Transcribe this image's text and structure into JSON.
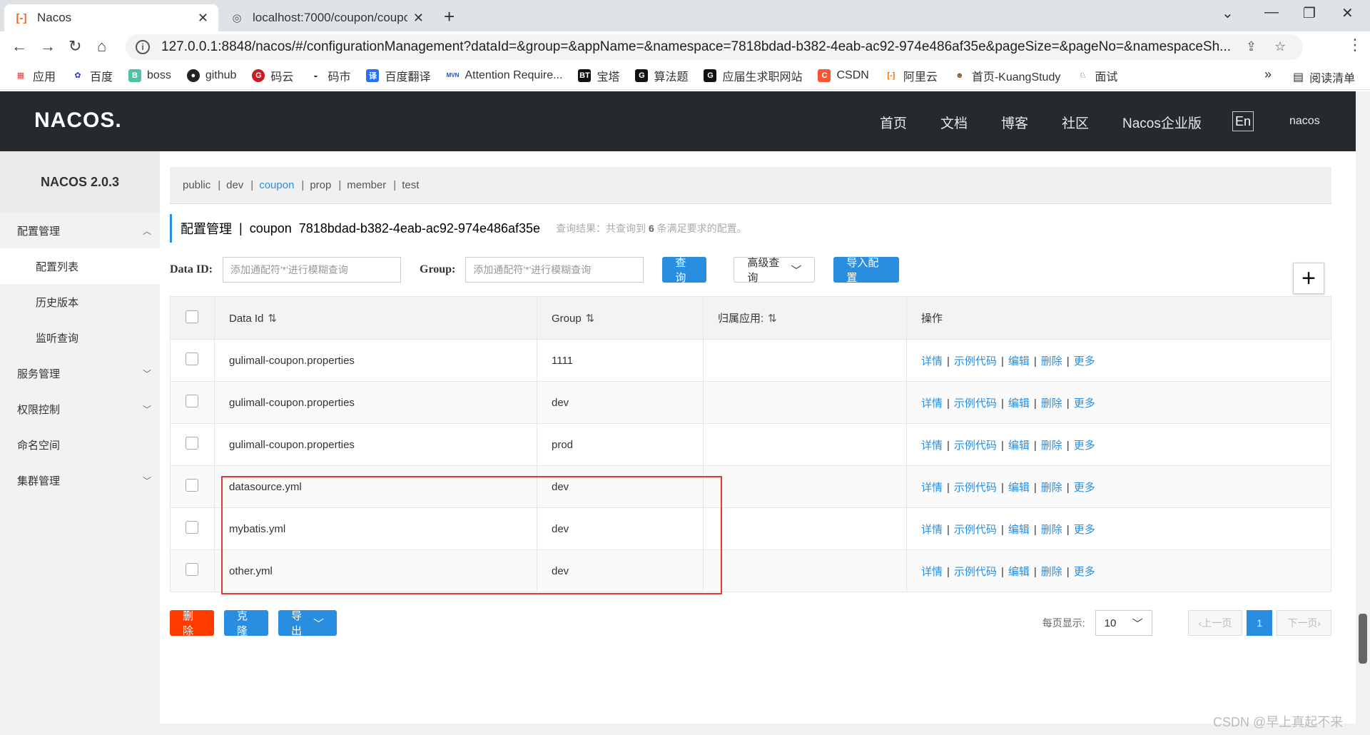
{
  "browser": {
    "tabs": [
      {
        "title": "Nacos",
        "active": true
      },
      {
        "title": "localhost:7000/coupon/coupo",
        "active": false
      }
    ],
    "url": "127.0.0.1:8848/nacos/#/configurationManagement?dataId=&group=&appName=&namespace=7818bdad-b382-4eab-ac92-974e486af35e&pageSize=&pageNo=&namespaceSh...",
    "bookmarks": [
      "应用",
      "百度",
      "boss",
      "github",
      "码云",
      "码市",
      "百度翻译",
      "Attention Require...",
      "宝塔",
      "算法题",
      "应届生求职网站",
      "CSDN",
      "阿里云",
      "首页-KuangStudy",
      "面试"
    ],
    "reading_list": "阅读清单"
  },
  "header": {
    "logo": "NACOS.",
    "nav": [
      "首页",
      "文档",
      "博客",
      "社区",
      "Nacos企业版"
    ],
    "lang": "En",
    "user": "nacos"
  },
  "sidebar": {
    "version": "NACOS 2.0.3",
    "items": [
      {
        "label": "配置管理",
        "level": 1
      },
      {
        "label": "配置列表",
        "level": 2
      },
      {
        "label": "历史版本",
        "level": 2
      },
      {
        "label": "监听查询",
        "level": 2
      },
      {
        "label": "服务管理",
        "level": 1
      },
      {
        "label": "权限控制",
        "level": 1
      },
      {
        "label": "命名空间",
        "level": 1
      },
      {
        "label": "集群管理",
        "level": 1
      }
    ]
  },
  "namespaces": [
    "public",
    "dev",
    "coupon",
    "prop",
    "member",
    "test"
  ],
  "active_namespace": "coupon",
  "title": {
    "main": "配置管理",
    "separator": "|",
    "namespace": "coupon",
    "namespace_id": "7818bdad-b382-4eab-ac92-974e486af35e",
    "hint_prefix": "查询结果：共查询到",
    "count": "6",
    "hint_suffix": "条满足要求的配置。"
  },
  "filter": {
    "dataid_label": "Data ID:",
    "dataid_placeholder": "添加通配符'*'进行模糊查询",
    "group_label": "Group:",
    "group_placeholder": "添加通配符'*'进行模糊查询",
    "query_btn": "查询",
    "advanced_btn": "高级查询",
    "import_btn": "导入配置"
  },
  "table": {
    "headers": [
      "Data Id",
      "Group",
      "归属应用:",
      "操作"
    ],
    "rows": [
      {
        "data_id": "gulimall-coupon.properties",
        "group": "1111",
        "app": ""
      },
      {
        "data_id": "gulimall-coupon.properties",
        "group": "dev",
        "app": ""
      },
      {
        "data_id": "gulimall-coupon.properties",
        "group": "prod",
        "app": ""
      },
      {
        "data_id": "datasource.yml",
        "group": "dev",
        "app": ""
      },
      {
        "data_id": "mybatis.yml",
        "group": "dev",
        "app": ""
      },
      {
        "data_id": "other.yml",
        "group": "dev",
        "app": ""
      }
    ],
    "ops": [
      "详情",
      "示例代码",
      "编辑",
      "删除",
      "更多"
    ]
  },
  "bottom": {
    "delete_btn": "删除",
    "clone_btn": "克隆",
    "export_btn": "导出",
    "per_page_label": "每页显示:",
    "per_page": "10",
    "prev": "上一页",
    "current_page": "1",
    "next": "下一页"
  },
  "watermark": "CSDN @早上真起不来",
  "colors": {
    "accent": "#2a8ee0",
    "danger": "#ff3d00",
    "highlight_box": "#e53935",
    "header_bg": "#252a2f"
  }
}
